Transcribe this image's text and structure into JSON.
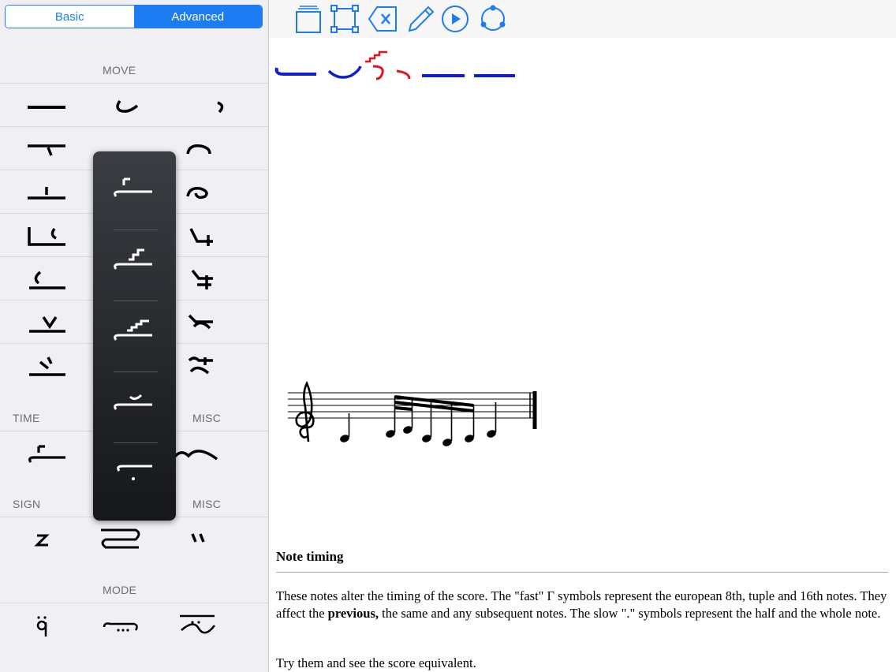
{
  "segmented": {
    "basic": "Basic",
    "advanced": "Advanced"
  },
  "sections": {
    "move": "MOVE",
    "time": "TIME",
    "misc": "MISC",
    "sign": "SIGN",
    "mode": "MODE"
  },
  "toolbar": {
    "icons": [
      "layers-icon",
      "select-box-icon",
      "delete-icon",
      "pencil-icon",
      "play-icon",
      "sync-icon"
    ]
  },
  "colors": {
    "accent": "#1e7cf2",
    "glyph_blue": "#1020c8",
    "glyph_red": "#e0141e",
    "popup_bg": "#22252a"
  },
  "content": {
    "title": "Note timing",
    "para1_a": "These notes alter the timing of the score. The \"fast\" Γ symbols represent the european 8th, tuple and 16th notes. They affect the ",
    "para1_bold": "previous,",
    "para1_b": " the same and any subsequent notes. The slow \".\" symbols represent the half and the whole note.",
    "para2": "Try them and see the score equivalent."
  }
}
